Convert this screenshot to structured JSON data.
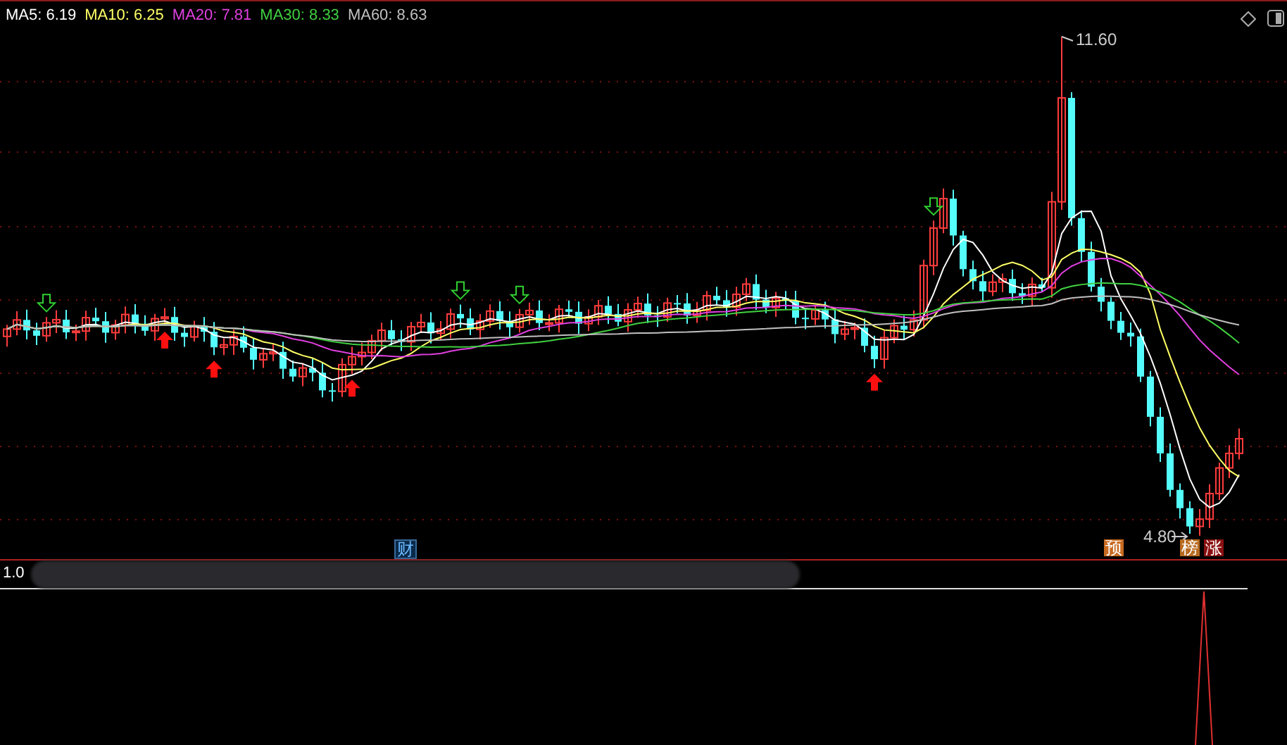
{
  "legend": [
    {
      "text": "MA5: 6.19",
      "color": "#ffffff"
    },
    {
      "text": "MA10: 6.25",
      "color": "#ffff66"
    },
    {
      "text": "MA20: 7.81",
      "color": "#e040e0"
    },
    {
      "text": "MA30: 8.33",
      "color": "#40d040"
    },
    {
      "text": "MA60: 8.63",
      "color": "#c0c0c0"
    }
  ],
  "high_label": "11.60",
  "low_label": "4.80",
  "tags": [
    {
      "text": "财",
      "kind": "finance"
    },
    {
      "text": "预",
      "kind": "forecast"
    },
    {
      "text": "榜",
      "kind": "list"
    },
    {
      "text": "涨",
      "kind": "limit"
    }
  ],
  "indicator": {
    "value": "1.0"
  }
}
